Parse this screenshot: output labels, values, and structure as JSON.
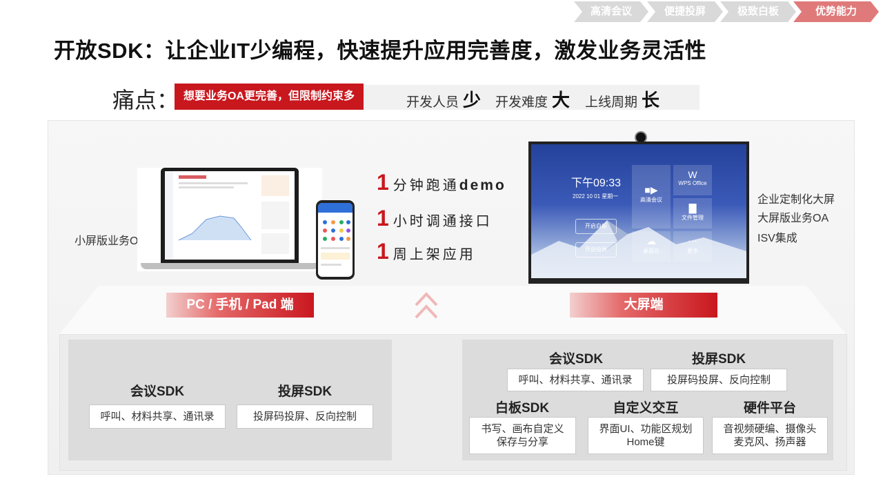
{
  "breadcrumb": [
    {
      "label": "高清会议",
      "active": false
    },
    {
      "label": "便捷投屏",
      "active": false
    },
    {
      "label": "极致白板",
      "active": false
    },
    {
      "label": "优势能力",
      "active": true
    }
  ],
  "title": "开放SDK：让企业IT少编程，快速提升应用完善度，激发业务灵活性",
  "pain": {
    "label": "痛点：",
    "tag": "想要业务OA更完善，但限制约束多",
    "metrics": [
      {
        "label": "开发人员",
        "value": "少"
      },
      {
        "label": "开发难度",
        "value": "大"
      },
      {
        "label": "上线周期",
        "value": "长"
      }
    ]
  },
  "left_device": {
    "side_label": "小屏版业务OA",
    "badge": "PC / 手机 / Pad 端"
  },
  "claims": [
    {
      "num": "1",
      "text": "分钟跑通",
      "en": "demo"
    },
    {
      "num": "1",
      "text": "小时调通接口",
      "en": ""
    },
    {
      "num": "1",
      "text": "周上架应用",
      "en": ""
    }
  ],
  "right_device": {
    "side_labels": [
      "企业定制化大屏",
      "大屏版业务OA",
      "ISV集成"
    ],
    "badge": "大屏端",
    "screen": {
      "time": "下午09:33",
      "date": "2022 10 01  星期一",
      "buttons": [
        "开启白板",
        "开启投屏"
      ],
      "tiles": [
        "高清会议",
        "WPS Office",
        "文件管理",
        "桌面云",
        "更多"
      ]
    }
  },
  "left_panel": {
    "items": [
      {
        "title": "会议SDK",
        "desc": "呼叫、材料共享、通讯录"
      },
      {
        "title": "投屏SDK",
        "desc": "投屏码投屏、反向控制"
      }
    ]
  },
  "right_panel": {
    "top": [
      {
        "title": "会议SDK",
        "desc": "呼叫、材料共享、通讯录"
      },
      {
        "title": "投屏SDK",
        "desc": "投屏码投屏、反向控制"
      }
    ],
    "bottom": [
      {
        "title": "白板SDK",
        "desc1": "书写、画布自定义",
        "desc2": "保存与分享"
      },
      {
        "title": "自定义交互",
        "desc1": "界面UI、功能区规划",
        "desc2": "Home键"
      },
      {
        "title": "硬件平台",
        "desc1": "音视频硬编、摄像头",
        "desc2": "麦克风、扬声器"
      }
    ]
  },
  "colors": {
    "accent": "#c9171e",
    "crumb_active": "#e07a7a",
    "crumb": "#d9d9d9"
  }
}
